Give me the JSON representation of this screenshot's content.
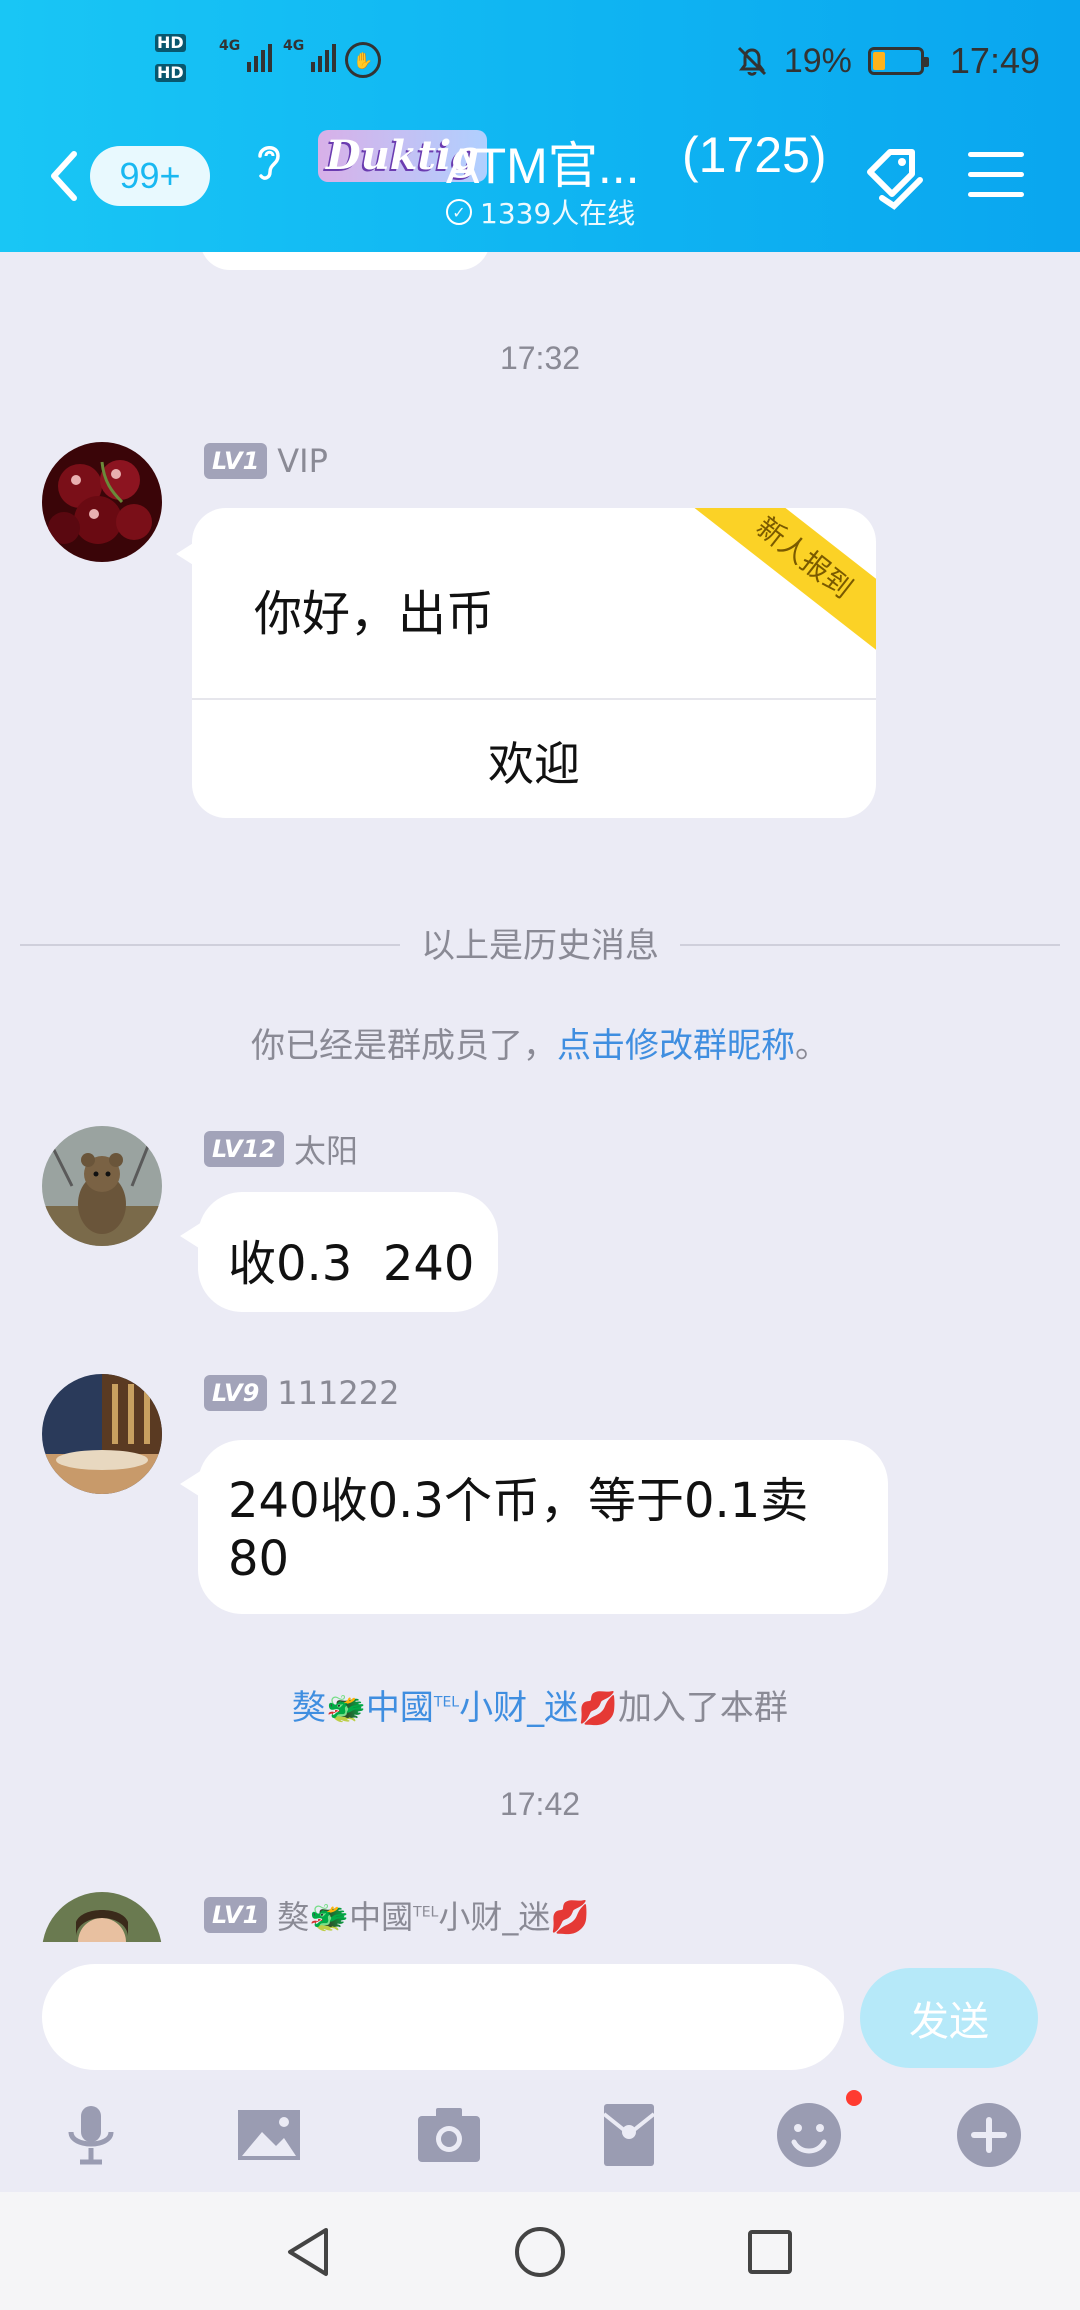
{
  "status_bar": {
    "hd1": "HD",
    "hd2": "HD",
    "net1": "4G",
    "net2": "4G",
    "battery_percent": "19%",
    "battery_level": 0.19,
    "time": "17:49"
  },
  "header": {
    "unread_badge": "99+",
    "group_logo_text": "Duktig",
    "group_title": "ATM官...",
    "member_count": "(1725)",
    "online_text": "1339人在线"
  },
  "chat": {
    "timestamp_1": "17:32",
    "msg1": {
      "level": "LV1",
      "sender": "VIP",
      "text": "你好，出币",
      "ribbon": "新人报到",
      "action": "欢迎"
    },
    "history_divider": "以上是历史消息",
    "member_note_prefix": "你已经是群成员了，",
    "member_note_link": "点击修改群昵称",
    "member_note_suffix": "。",
    "msg2": {
      "level": "LV12",
      "sender": "太阳",
      "text": "收0.3  240"
    },
    "msg3": {
      "level": "LV9",
      "sender": "111222",
      "text_line1": "240收0.3个币，等于0.1卖",
      "text_line2": "80"
    },
    "join_note": {
      "name_part1": "獒",
      "name_part2": "中國",
      "name_sup": "TEL",
      "name_part3": "小财_迷",
      "suffix": "加入了本群"
    },
    "timestamp_2": "17:42",
    "msg4": {
      "level": "LV1",
      "sender_part1": "獒",
      "sender_part2": "中國",
      "sender_sup": "TEL",
      "sender_part3": "小财_迷"
    }
  },
  "input_bar": {
    "placeholder": "",
    "send_label": "发送"
  },
  "colors": {
    "header_gradient_start": "#19c6f5",
    "header_gradient_end": "#0aa6ef",
    "chat_background": "#ebebf5",
    "link": "#3f8ee0",
    "ribbon": "#fbd226",
    "send_button": "#b6e9f9"
  }
}
